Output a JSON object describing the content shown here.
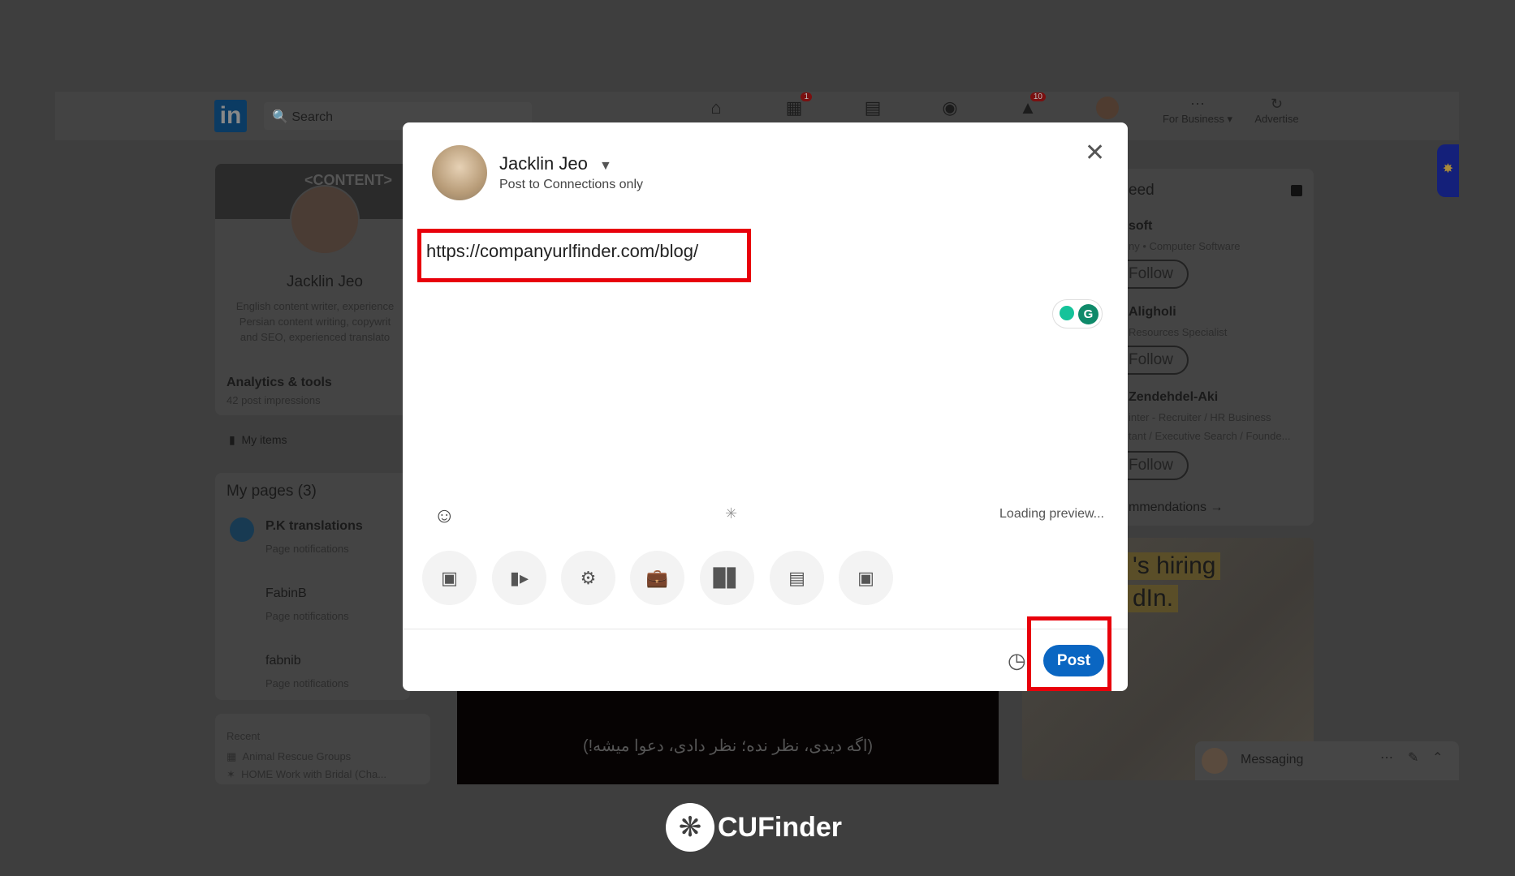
{
  "nav": {
    "search_placeholder": "Search",
    "logo": "in",
    "badges": {
      "my_network": "1",
      "notifications": "10"
    },
    "for_business": "For Business",
    "advertise": "Advertise"
  },
  "profile": {
    "name": "Jacklin Jeo",
    "headline": [
      "English content writer, experience",
      "Persian content writing, copywrit",
      "and SEO, experienced translato"
    ],
    "cover_text": "<CONTENT>",
    "analytics_title": "Analytics & tools",
    "analytics_sub": "42 post impressions",
    "my_items": "My items"
  },
  "pages": {
    "title": "My pages (3)",
    "items": [
      {
        "name": "P.K translations",
        "sub": "Page notifications"
      },
      {
        "name": "FabinB",
        "sub": "Page notifications"
      },
      {
        "name": "fabnib",
        "sub": "Page notifications"
      }
    ]
  },
  "recent": {
    "title": "Recent",
    "items": [
      "Animal Rescue Groups",
      "HOME Work with Bridal (Cha..."
    ]
  },
  "right_rail": {
    "title": "eed",
    "items": [
      {
        "name": "soft",
        "sub": [
          "ny • Computer Software"
        ],
        "follow": "Follow"
      },
      {
        "name": "Aligholi",
        "sub": [
          " Resources Specialist"
        ],
        "follow": "Follow"
      },
      {
        "name": "Zendehdel-Aki",
        "sub": [
          "inter - Recruiter / HR Business",
          "tant / Executive Search / Founde..."
        ],
        "follow": "Follow"
      }
    ],
    "recommendations": "mmendations →"
  },
  "ad": {
    "line1": "'s hiring",
    "line2": "dIn."
  },
  "video_caption": "(اگه دیدی، نظر نده؛ نظر دادی، دعوا میشه!)",
  "messaging": {
    "label": "Messaging"
  },
  "modal": {
    "author": "Jacklin Jeo",
    "visibility": "Post to Connections only",
    "post_text": "https://companyurlfinder.com/blog/",
    "loading": "Loading preview...",
    "post_button": "Post",
    "tools": [
      "image-icon",
      "video-icon",
      "celebrate-icon",
      "job-icon",
      "poll-icon",
      "document-icon",
      "hiring-icon"
    ],
    "highlight_color": "#e8000b",
    "accent": "#0a66c2"
  },
  "watermark": {
    "text": "CUFinder"
  }
}
